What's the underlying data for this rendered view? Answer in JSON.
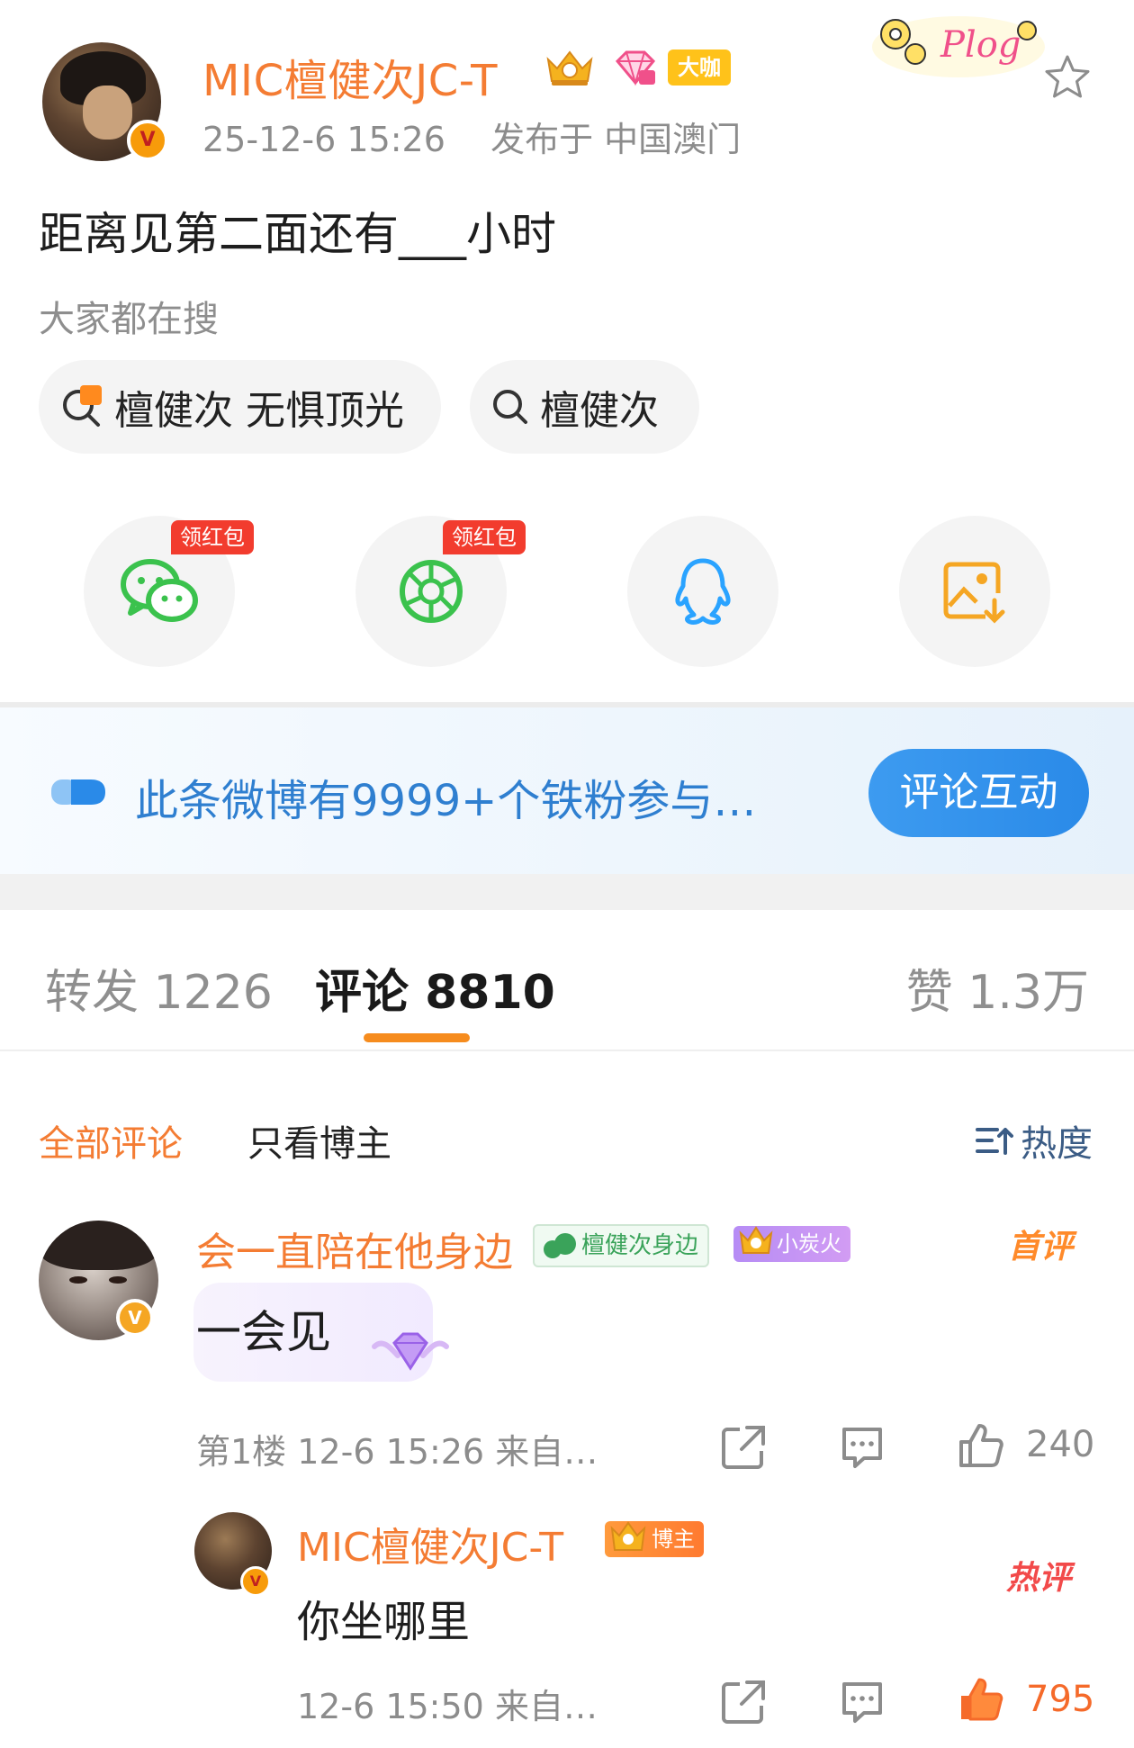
{
  "post": {
    "author": "MIC檀健次JC-T",
    "badge_dakan": "大咖",
    "time": "25-12-6 15:26",
    "location": "发布于 中国澳门",
    "text": "距离见第二面还有___小时",
    "sticker_text": "Plog",
    "verified_mark": "V"
  },
  "search": {
    "label": "大家都在搜",
    "chips": [
      {
        "text": "檀健次 无惧顶光",
        "icon": "hot-search-icon"
      },
      {
        "text": "檀健次",
        "icon": "search-icon"
      }
    ]
  },
  "share": {
    "redpack_label": "领红包",
    "items": [
      {
        "name": "wechat",
        "icon": "wechat-icon",
        "color": "#3bc24d"
      },
      {
        "name": "moments",
        "icon": "moments-icon",
        "color": "#3bc24d"
      },
      {
        "name": "qq",
        "icon": "qq-icon",
        "color": "#2aa3ff"
      },
      {
        "name": "save-image",
        "icon": "save-image-icon",
        "color": "#f5a623"
      }
    ]
  },
  "banner": {
    "text": "此条微博有9999+个铁粉参与…",
    "button": "评论互动"
  },
  "tabs": {
    "forward": "转发 1226",
    "comment": "评论 8810",
    "like": "赞 1.3万"
  },
  "filters": {
    "all": "全部评论",
    "blogger_only": "只看博主",
    "sort": "热度"
  },
  "comments": [
    {
      "name": "会一直陪在他身边",
      "fan_badge": "檀健次身边",
      "level_badge": "小炭火",
      "tag": "首评",
      "text": "一会见",
      "floor": "第1楼",
      "time": "12-6 15:26",
      "source": "来自…",
      "likes": "240",
      "reply": {
        "name": "MIC檀健次JC-T",
        "badge": "博主",
        "tag": "热评",
        "text": "你坐哪里",
        "time": "12-6 15:50",
        "source": "来自…",
        "likes": "795"
      }
    }
  ],
  "colors": {
    "accent_orange": "#f47c33",
    "blue": "#2f7fd0",
    "like_active": "#f56a2a"
  }
}
